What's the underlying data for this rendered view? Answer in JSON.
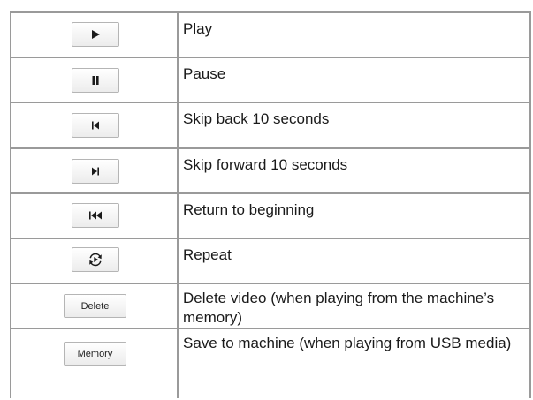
{
  "rows": [
    {
      "icon": "play-icon",
      "description": "Play"
    },
    {
      "icon": "pause-icon",
      "description": "Pause"
    },
    {
      "icon": "skip-back-icon",
      "description": "Skip back 10 seconds"
    },
    {
      "icon": "skip-forward-icon",
      "description": "Skip forward 10 seconds"
    },
    {
      "icon": "return-to-beginning-icon",
      "description": "Return to beginning"
    },
    {
      "icon": "repeat-icon",
      "description": "Repeat"
    },
    {
      "button_label": "Delete",
      "description": "Delete video (when playing from the machine’s memory)"
    },
    {
      "button_label": "Memory",
      "description": "Save to machine (when playing from USB media)"
    }
  ]
}
